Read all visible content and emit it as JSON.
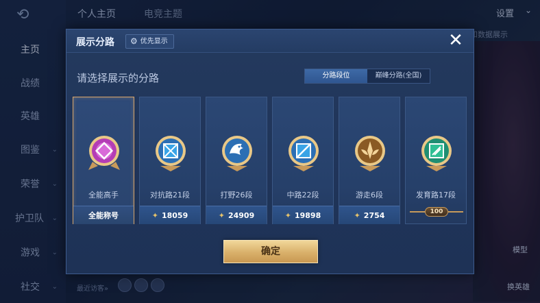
{
  "background": {
    "top_tabs": [
      "个人主页",
      "电竞主题"
    ],
    "sidebar": [
      {
        "label": "主页",
        "active": true
      },
      {
        "label": "战绩",
        "active": false
      },
      {
        "label": "英雄",
        "active": false
      },
      {
        "label": "图鉴",
        "active": false
      },
      {
        "label": "荣誉",
        "active": false
      },
      {
        "label": "护卫队",
        "active": false
      },
      {
        "label": "游戏",
        "active": false
      },
      {
        "label": "社交",
        "active": false
      }
    ],
    "settings_label": "设置",
    "right_snippet": "和数据展示",
    "model_label": "模型",
    "switch_hero_label": "换英雄",
    "recent_visitors": "最近访客»"
  },
  "modal": {
    "title": "展示分路",
    "priority_button": "优先显示",
    "subtitle": "请选择展示的分路",
    "segments": [
      {
        "label": "分路段位",
        "active": true
      },
      {
        "label": "巅峰分路(全国)",
        "active": false
      }
    ],
    "cards": [
      {
        "label": "全能高手",
        "footer": "全能称号",
        "icon": "allround-badge-icon",
        "selected": true,
        "accent": "#b43db5"
      },
      {
        "label": "对抗路21段",
        "points": "18059",
        "icon": "clash-lane-badge-icon",
        "selected": false,
        "accent": "#3aa4e6"
      },
      {
        "label": "打野26段",
        "points": "24909",
        "icon": "jungle-badge-icon",
        "selected": false,
        "accent": "#3b86d6"
      },
      {
        "label": "中路22段",
        "points": "19898",
        "icon": "mid-lane-badge-icon",
        "selected": false,
        "accent": "#3aa4e6"
      },
      {
        "label": "游走6段",
        "points": "2754",
        "icon": "roam-badge-icon",
        "selected": false,
        "accent": "#c98a3c"
      },
      {
        "label": "发育路17段",
        "rank_badge": "100",
        "icon": "farm-lane-badge-icon",
        "selected": false,
        "accent": "#2fbf94"
      }
    ],
    "confirm_label": "确定"
  },
  "colors": {
    "gold": "#d9b06a",
    "panel": "#20355a",
    "selected_border": "#d9a66a"
  }
}
